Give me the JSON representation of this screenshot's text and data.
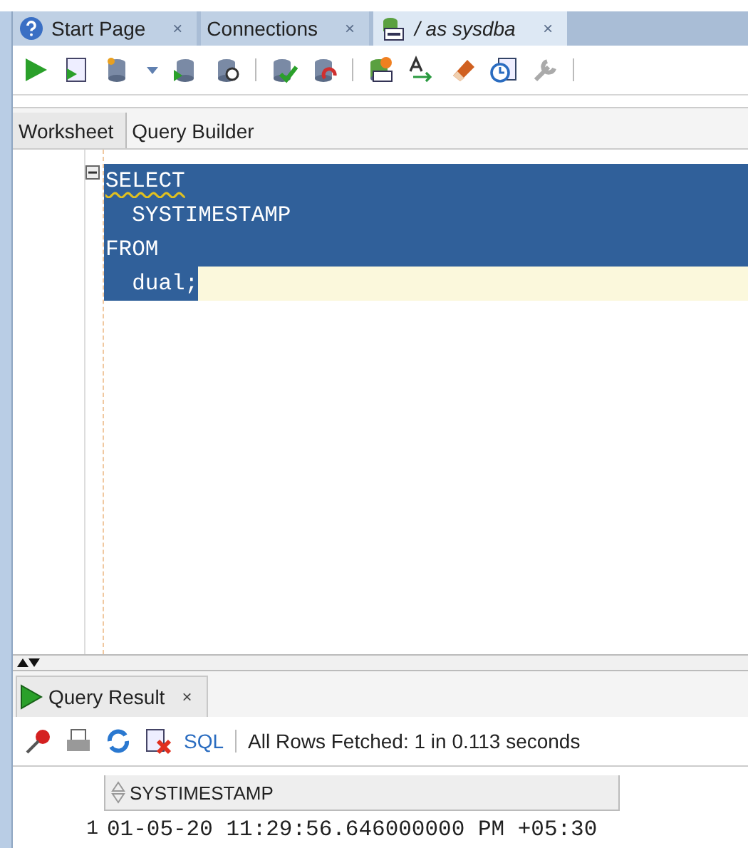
{
  "tabs": [
    {
      "label": "Start Page",
      "kind": "help",
      "selected": false,
      "close": "×"
    },
    {
      "label": "Connections",
      "kind": "plain",
      "selected": false,
      "close": "×"
    },
    {
      "label": "/ as sysdba",
      "kind": "sql",
      "selected": true,
      "close": "×"
    }
  ],
  "subtabs": [
    {
      "label": "Worksheet",
      "selected": true
    },
    {
      "label": "Query Builder",
      "selected": false
    }
  ],
  "editor": {
    "lines": [
      {
        "text": "SELECT",
        "selected": true,
        "current": false,
        "warning": true
      },
      {
        "text": "  SYSTIMESTAMP",
        "selected": true,
        "current": false,
        "warning": false
      },
      {
        "text": "FROM",
        "selected": true,
        "current": false,
        "warning": false
      },
      {
        "text": "  dual;",
        "selected": true,
        "current": true,
        "warning": false
      }
    ]
  },
  "result": {
    "tab": {
      "label": "Query Result",
      "close": "×"
    },
    "sql_link": "SQL",
    "status": "All Rows Fetched: 1 in 0.113 seconds",
    "columns": [
      "SYSTIMESTAMP"
    ],
    "rows": [
      {
        "number": "1",
        "cells": [
          "01-05-20 11:29:56.646000000 PM +05:30"
        ]
      }
    ]
  }
}
